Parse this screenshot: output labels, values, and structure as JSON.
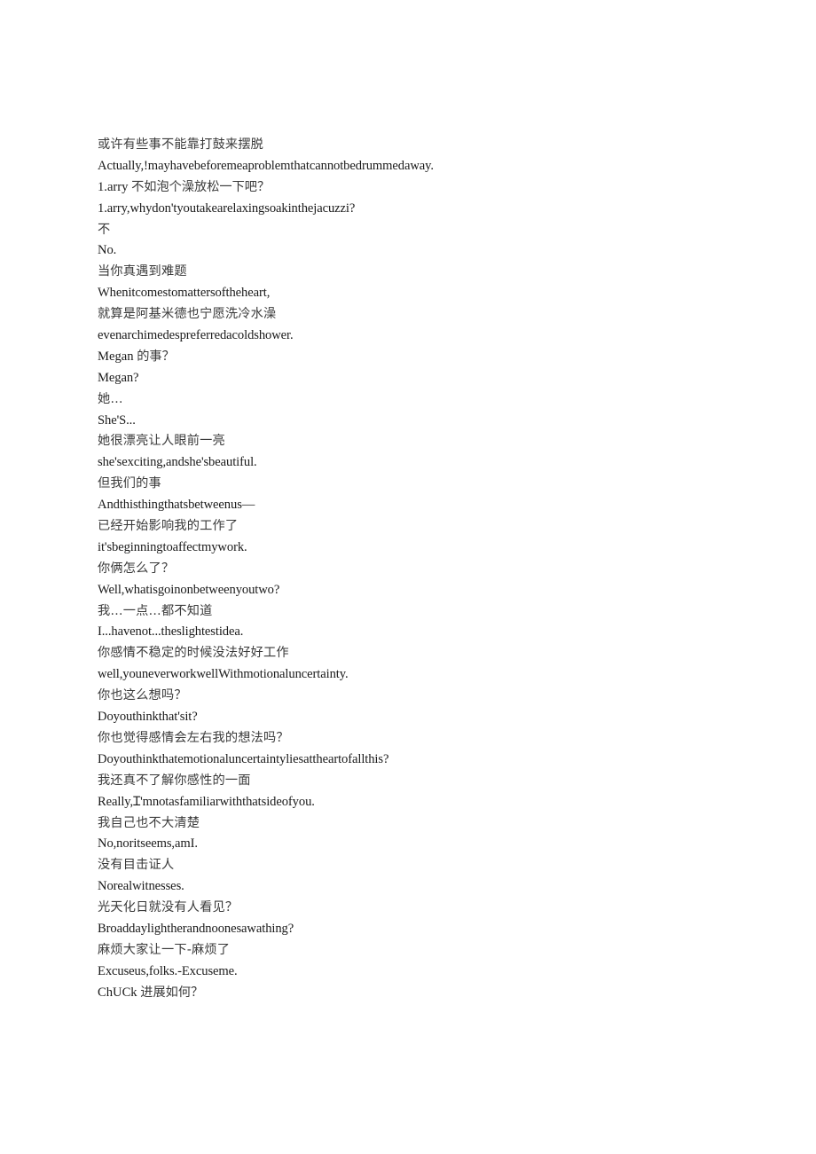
{
  "document": {
    "page_background": "#ffffff",
    "text_color_latin": "#1a1a1a",
    "text_color_han": "#3a3a3a",
    "lines": [
      {
        "script": "han",
        "text": "或许有些事不能靠打鼓来摆脱"
      },
      {
        "script": "latin",
        "text": "Actually,!mayhavebeforemeaproblemthatcannotbedrummedaway."
      },
      {
        "script": "mixed",
        "text": "1.arry 不如泡个澡放松一下吧？",
        "latin_part": "1.arry ",
        "han_part": "不如泡个澡放松一下吧？"
      },
      {
        "script": "latin",
        "text": "1.arry,whydon'tyoutakearelaxingsoakinthejacuzzi?"
      },
      {
        "script": "han",
        "text": "不"
      },
      {
        "script": "latin",
        "text": "No."
      },
      {
        "script": "han",
        "text": "当你真遇到难题"
      },
      {
        "script": "latin",
        "text": "Whenitcomestomattersoftheheart,"
      },
      {
        "script": "han",
        "text": "就算是阿基米德也宁愿洗冷水澡"
      },
      {
        "script": "latin",
        "text": "evenarchimedespreferredacoldshower."
      },
      {
        "script": "mixed",
        "text": "Megan 的事？",
        "latin_part": "Megan ",
        "han_part": "的事？"
      },
      {
        "script": "latin",
        "text": "Megan?"
      },
      {
        "script": "han",
        "text": "她…"
      },
      {
        "script": "latin",
        "text": "She'S..."
      },
      {
        "script": "han",
        "text": "她很漂亮让人眼前一亮"
      },
      {
        "script": "latin",
        "text": "she'sexciting,andshe'sbeautiful."
      },
      {
        "script": "han",
        "text": "但我们的事"
      },
      {
        "script": "latin",
        "text": "Andthisthingthatsbetweenus—"
      },
      {
        "script": "han",
        "text": "已经开始影响我的工作了"
      },
      {
        "script": "latin",
        "text": "it'sbeginningtoaffectmywork."
      },
      {
        "script": "han",
        "text": "你俩怎么了？"
      },
      {
        "script": "latin",
        "text": "Well,whatisgoinonbetweenyoutwo?"
      },
      {
        "script": "han",
        "text": "我…一点…都不知道"
      },
      {
        "script": "latin",
        "text": "I...havenot...theslightestidea."
      },
      {
        "script": "han",
        "text": "你感情不稳定的时候没法好好工作"
      },
      {
        "script": "latin",
        "text": "well,youneverworkwellWithmotionaluncertainty."
      },
      {
        "script": "han",
        "text": "你也这么想吗？"
      },
      {
        "script": "latin",
        "text": "Doyouthinkthat'sit?"
      },
      {
        "script": "han",
        "text": "你也觉得感情会左右我的想法吗？"
      },
      {
        "script": "latin",
        "text": "Doyouthinkthatemotionaluncertaintyliesattheartofallthis?"
      },
      {
        "script": "han",
        "text": "我还真不了解你感性的一面"
      },
      {
        "script": "latin",
        "text": "Really,Ɪ'mnotasfamiliarwiththatsideofyou."
      },
      {
        "script": "han",
        "text": "我自己也不大清楚"
      },
      {
        "script": "latin",
        "text": "No,noritseems,amI."
      },
      {
        "script": "han",
        "text": "没有目击证人"
      },
      {
        "script": "latin",
        "text": "Norealwitnesses."
      },
      {
        "script": "han",
        "text": "光天化日就没有人看见？"
      },
      {
        "script": "latin",
        "text": "Broaddaylightherandnoonesawathing?"
      },
      {
        "script": "han",
        "text": "麻烦大家让一下-麻烦了"
      },
      {
        "script": "latin",
        "text": "Excuseus,folks.-Excuseme."
      },
      {
        "script": "mixed",
        "text": "ChUCk 进展如何？",
        "latin_part": "ChUCk ",
        "han_part": "进展如何？"
      }
    ]
  }
}
